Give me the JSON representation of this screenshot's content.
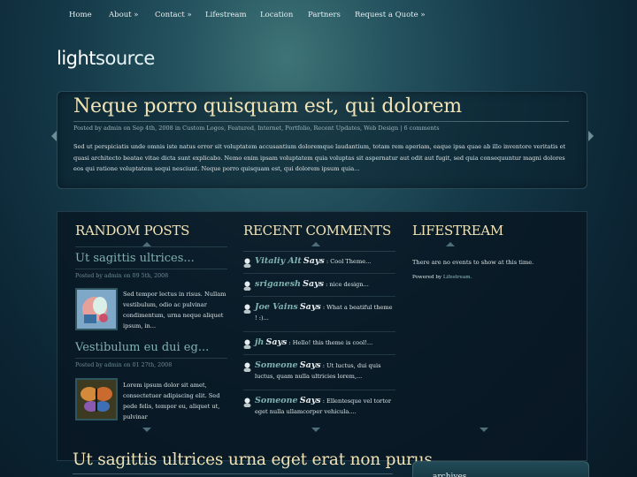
{
  "nav": {
    "home": "Home",
    "about": "About »",
    "contact": "Contact »",
    "lifestream": "Lifestream",
    "location": "Location",
    "partners": "Partners",
    "quote": "Request a Quote »"
  },
  "logo": {
    "part1": "light",
    "part2": "source"
  },
  "featured": {
    "title": "Neque porro quisquam est, qui dolorem",
    "meta": "Posted by admin on Sep 4th, 2008 in Custom Logos, Featured, Internet, Portfolio, Recent Updates, Web Design | 6 comments",
    "text": "Sed ut perspiciatis unde omnis iste natus error sit voluptatem accusantium doloremque laudantium, totam rem aperiam, eaque ipsa quae ab illo inventore veritatis et quasi architecto beatae vitae dicta sunt explicabo. Nemo enim ipsam voluptatem quia voluptas sit aspernatur aut odit aut fugit, sed quia consequuntur magni dolores eos qui ratione voluptatem sequi nesciunt. Neque porro quisquam est, qui dolorem ipsum quia..."
  },
  "random_posts": {
    "heading": "RANDOM POSTS",
    "items": [
      {
        "title": "Ut sagittis ultrices...",
        "meta": "Posted by admin on 09 5th, 2008",
        "excerpt": "Sed tempor lectus in risus. Nullam vestibulum, odio ac pulvinar condimentum, urna neque aliquet ipsum, in..."
      },
      {
        "title": "Vestibulum eu dui eg...",
        "meta": "Posted by admin on 01 27th, 2008",
        "excerpt": "Lorem ipsum dolor sit amet, consectetuer adipiscing elit. Sed pede felis, tempor eu, aliquet ut, pulvinar"
      }
    ]
  },
  "recent_comments": {
    "heading": "RECENT COMMENTS",
    "says": "Says",
    "items": [
      {
        "author": "Vitaliy Alt",
        "text": ": Cool Theme..."
      },
      {
        "author": "sriganesh",
        "text": ": nice design..."
      },
      {
        "author": "Joe Vains",
        "text": ": What a beatiful theme ! :)..."
      },
      {
        "author": "jh",
        "text": ": Hello! this theme is cool!..."
      },
      {
        "author": "Someone",
        "text": ": Ut luctus, dui quis luctus, quam nulla ultricies lorem,..."
      },
      {
        "author": "Someone",
        "text": ": Ellentesque vel tortor eget nulla ullamcorper vehicula...."
      }
    ]
  },
  "lifestream": {
    "heading": "LIFESTREAM",
    "empty": "There are no events to show at this time.",
    "powered_prefix": "Powered by",
    "powered_link": "Lifestream."
  },
  "bottom": {
    "post_title": "Ut sagittis ultrices urna eget erat non purus",
    "archives": "archives"
  },
  "colors": {
    "heading": "#f1e3b5",
    "link_teal": "#7fb2b0",
    "background": "#0c2635"
  }
}
